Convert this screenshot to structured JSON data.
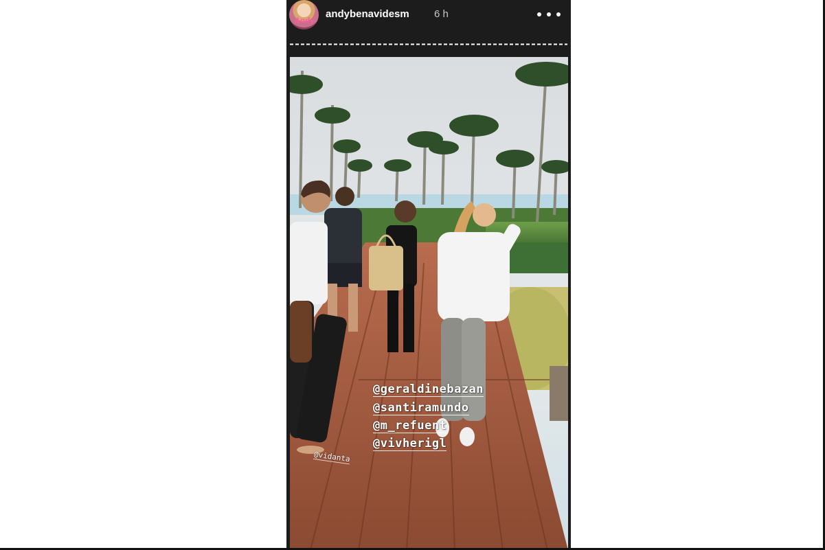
{
  "story": {
    "username": "andybenavidesm",
    "time_ago": "6 h",
    "avatar_signature": "Andy",
    "more_icon": "more-horizontal-icon",
    "progress_segments": 1,
    "progress_segments_complete": 0
  },
  "photo": {
    "mentions": [
      "@geraldinebazan",
      "@santiramundo",
      "@m_refuent",
      "@vivherigl"
    ],
    "location_tag": "@vidanta"
  },
  "colors": {
    "header_bg": "#1c1c1c",
    "username": "#ffffff",
    "time": "#c8c8c8",
    "mention_text": "#ffffff"
  }
}
